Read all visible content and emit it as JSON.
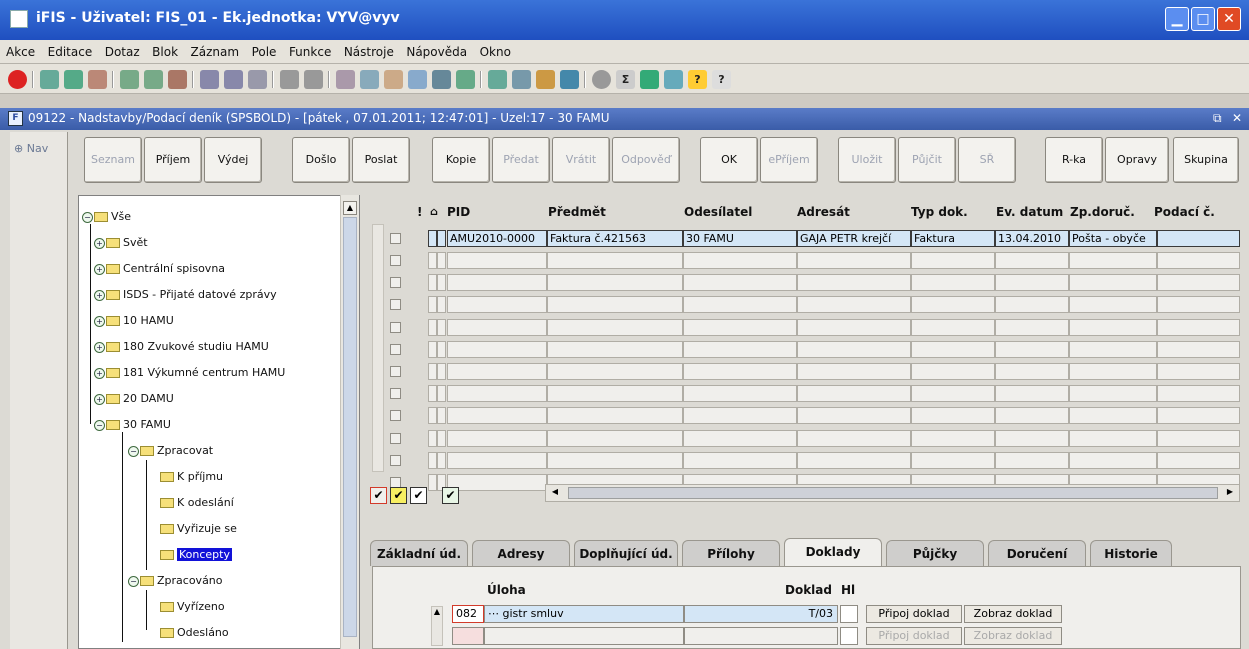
{
  "window": {
    "title": "iFIS - Uživatel: FIS_01 - Ek.jednotka: VYV@vyv"
  },
  "menu": [
    "Akce",
    "Editace",
    "Dotaz",
    "Blok",
    "Záznam",
    "Pole",
    "Funkce",
    "Nástroje",
    "Nápověda",
    "Okno"
  ],
  "form": {
    "title": "09122 - Nadstavby/Podací deník (SPSBOLD) - [pátek , 07.01.2011; 12:47:01] - Uzel:17 - 30 FAMU",
    "nav_label": "Nav"
  },
  "buttons": {
    "seznam": "Seznam",
    "prijem": "Příjem",
    "vydej": "Výdej",
    "doslo": "Došlo",
    "poslat": "Poslat",
    "kopie": "Kopie",
    "predat": "Předat",
    "vratit": "Vrátit",
    "odpoved": "Odpověď",
    "ok": "OK",
    "eprijem": "ePříjem",
    "ulozit": "Uložit",
    "pujcit": "Půjčit",
    "sr": "SŘ",
    "rka": "R-ka",
    "opravy": "Opravy",
    "skupina": "Skupina"
  },
  "tree": {
    "root": "Vše",
    "items": [
      "Svět",
      "Centrální spisovna",
      "ISDS - Přijaté datové zprávy",
      "10 HAMU",
      "180 Zvukové studiu HAMU",
      "181 Výkumné centrum HAMU",
      "20 DAMU",
      "30 FAMU"
    ],
    "zpracovat": "Zpracovat",
    "zpracovat_children": [
      "K příjmu",
      "K odeslání",
      "Vyřizuje se",
      "Koncepty"
    ],
    "zpracovano": "Zpracováno",
    "zpracovano_children": [
      "Vyřízeno",
      "Odesláno"
    ]
  },
  "grid": {
    "headers": {
      "excl": "!",
      "pid": "PID",
      "predmet": "Předmět",
      "odesilatel": "Odesílatel",
      "adresat": "Adresát",
      "typ": "Typ dok.",
      "evdatum": "Ev. datum",
      "zpdoruc": "Zp.doruč.",
      "podaci": "Podací č."
    },
    "row1": {
      "pid": "AMU2010-0000",
      "predmet": "Faktura č.421563",
      "odesilatel": "30 FAMU",
      "adresat": "GAJA PETR krejčí",
      "typ": "Faktura",
      "evdatum": "13.04.2010",
      "zpdoruc": "Pošta - obyče"
    },
    "empty_rows": 11
  },
  "tabs": {
    "zakladni": "Základní úd.",
    "adresy": "Adresy",
    "doplnujici": "Doplňující úd.",
    "prilohy": "Přílohy",
    "doklady": "Doklady",
    "pujcky": "Půjčky",
    "doruceni": "Doručení",
    "historie": "Historie"
  },
  "doklady": {
    "header_uloha": "Úloha",
    "header_doklad": "Doklad",
    "header_hl": "Hl",
    "row1_code": "082",
    "row1_name": "gistr smluv",
    "row1_doklad": "T/03",
    "pripoj": "Připoj doklad",
    "zobraz": "Zobraz doklad"
  }
}
